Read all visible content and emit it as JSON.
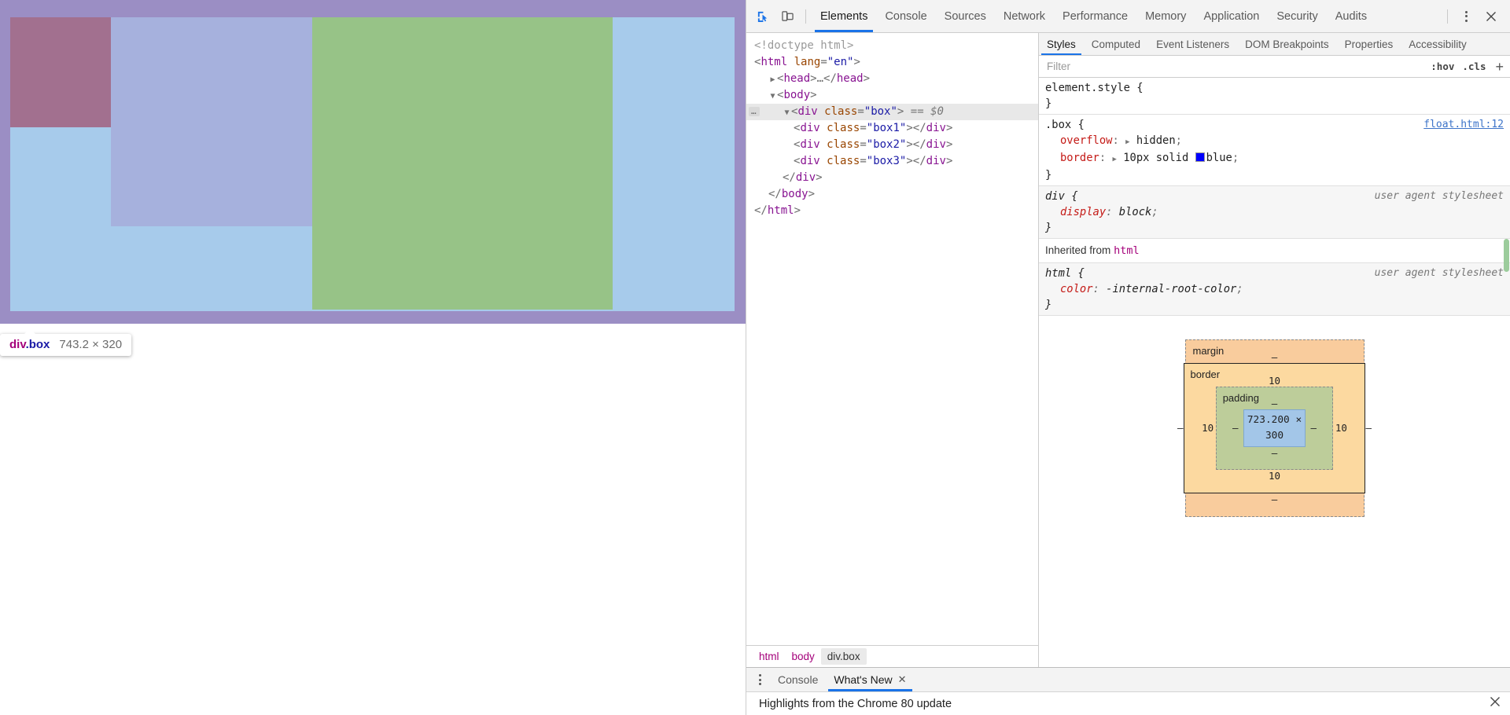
{
  "page_overlay": {
    "tooltip": {
      "tag": "div",
      "cls": ".box",
      "dimensions": "743.2 × 320"
    },
    "colors": {
      "highlight_margin": "#9b8ec4",
      "content": "#a7cbeb",
      "box1": "#a2708f",
      "box2": "#a6b1dd",
      "box3": "#97c387"
    }
  },
  "toolbar": {
    "inspect_icon": "inspect-element-icon",
    "device_icon": "device-toolbar-icon",
    "more_icon": "more-options-icon",
    "close_icon": "close-icon",
    "tabs": [
      {
        "label": "Elements",
        "active": true
      },
      {
        "label": "Console",
        "active": false
      },
      {
        "label": "Sources",
        "active": false
      },
      {
        "label": "Network",
        "active": false
      },
      {
        "label": "Performance",
        "active": false
      },
      {
        "label": "Memory",
        "active": false
      },
      {
        "label": "Application",
        "active": false
      },
      {
        "label": "Security",
        "active": false
      },
      {
        "label": "Audits",
        "active": false
      }
    ]
  },
  "dom_tree": {
    "lines": [
      {
        "text": "<!doctype html>",
        "type": "doctype"
      },
      {
        "text": "<html lang=\"en\">",
        "type": "tag"
      },
      {
        "text": "<head>…</head>",
        "type": "collapsed"
      },
      {
        "text": "<body>",
        "type": "tag"
      },
      {
        "text": "<div class=\"box\"> == $0",
        "type": "selected"
      },
      {
        "text": "<div class=\"box1\"></div>",
        "type": "tag"
      },
      {
        "text": "<div class=\"box2\"></div>",
        "type": "tag"
      },
      {
        "text": "<div class=\"box3\"></div>",
        "type": "tag"
      },
      {
        "text": "</div>",
        "type": "close"
      },
      {
        "text": "</body>",
        "type": "close"
      },
      {
        "text": "</html>",
        "type": "close"
      }
    ],
    "selected_marker": "$0",
    "ellipsis_badge": "…"
  },
  "breadcrumb": {
    "items": [
      {
        "label": "html",
        "selected": false
      },
      {
        "label": "body",
        "selected": false
      },
      {
        "label": "div.box",
        "selected": true
      }
    ]
  },
  "styles_panel": {
    "tabs": [
      {
        "label": "Styles",
        "active": true
      },
      {
        "label": "Computed",
        "active": false
      },
      {
        "label": "Event Listeners",
        "active": false
      },
      {
        "label": "DOM Breakpoints",
        "active": false
      },
      {
        "label": "Properties",
        "active": false
      },
      {
        "label": "Accessibility",
        "active": false
      }
    ],
    "filter": {
      "placeholder": "Filter",
      "value": ""
    },
    "hov_label": ":hov",
    "cls_label": ".cls",
    "new_rule_label": "+",
    "rules": [
      {
        "selector": "element.style {",
        "origin": "",
        "origin_is_link": false,
        "user_agent": false,
        "declarations": [],
        "close": "}"
      },
      {
        "selector": ".box {",
        "origin": "float.html:12",
        "origin_is_link": true,
        "user_agent": false,
        "declarations": [
          {
            "property": "overflow",
            "value": "hidden",
            "has_arrow": true,
            "swatch": ""
          },
          {
            "property": "border",
            "value": "10px solid blue",
            "has_arrow": true,
            "swatch": "#0000ff"
          }
        ],
        "close": "}"
      },
      {
        "selector": "div {",
        "origin": "user agent stylesheet",
        "origin_is_link": false,
        "user_agent": true,
        "declarations": [
          {
            "property": "display",
            "value": "block",
            "has_arrow": false,
            "swatch": ""
          }
        ],
        "close": "}"
      }
    ],
    "inherited_label": "Inherited from",
    "inherited_from_tag": "html",
    "inherited_rules": [
      {
        "selector": "html {",
        "origin": "user agent stylesheet",
        "origin_is_link": false,
        "user_agent": true,
        "declarations": [
          {
            "property": "color",
            "value": "-internal-root-color",
            "has_arrow": false,
            "swatch": ""
          }
        ],
        "close": "}"
      }
    ]
  },
  "box_model": {
    "margin_label": "margin",
    "border_label": "border",
    "padding_label": "padding",
    "content_size": "723.200 × 300",
    "margin": {
      "top": "–",
      "right": "–",
      "bottom": "–",
      "left": "–"
    },
    "border": {
      "top": "10",
      "right": "10",
      "bottom": "10",
      "left": "10"
    },
    "padding": {
      "top": "–",
      "right": "–",
      "bottom": "–",
      "left": "–"
    }
  },
  "drawer": {
    "more_icon": "more-options-icon",
    "tabs": [
      {
        "label": "Console",
        "active": false,
        "closable": false
      },
      {
        "label": "What's New",
        "active": true,
        "closable": true
      }
    ],
    "close_glyph": "✕",
    "content_text": "Highlights from the Chrome 80 update",
    "close_icon": "close-icon"
  }
}
